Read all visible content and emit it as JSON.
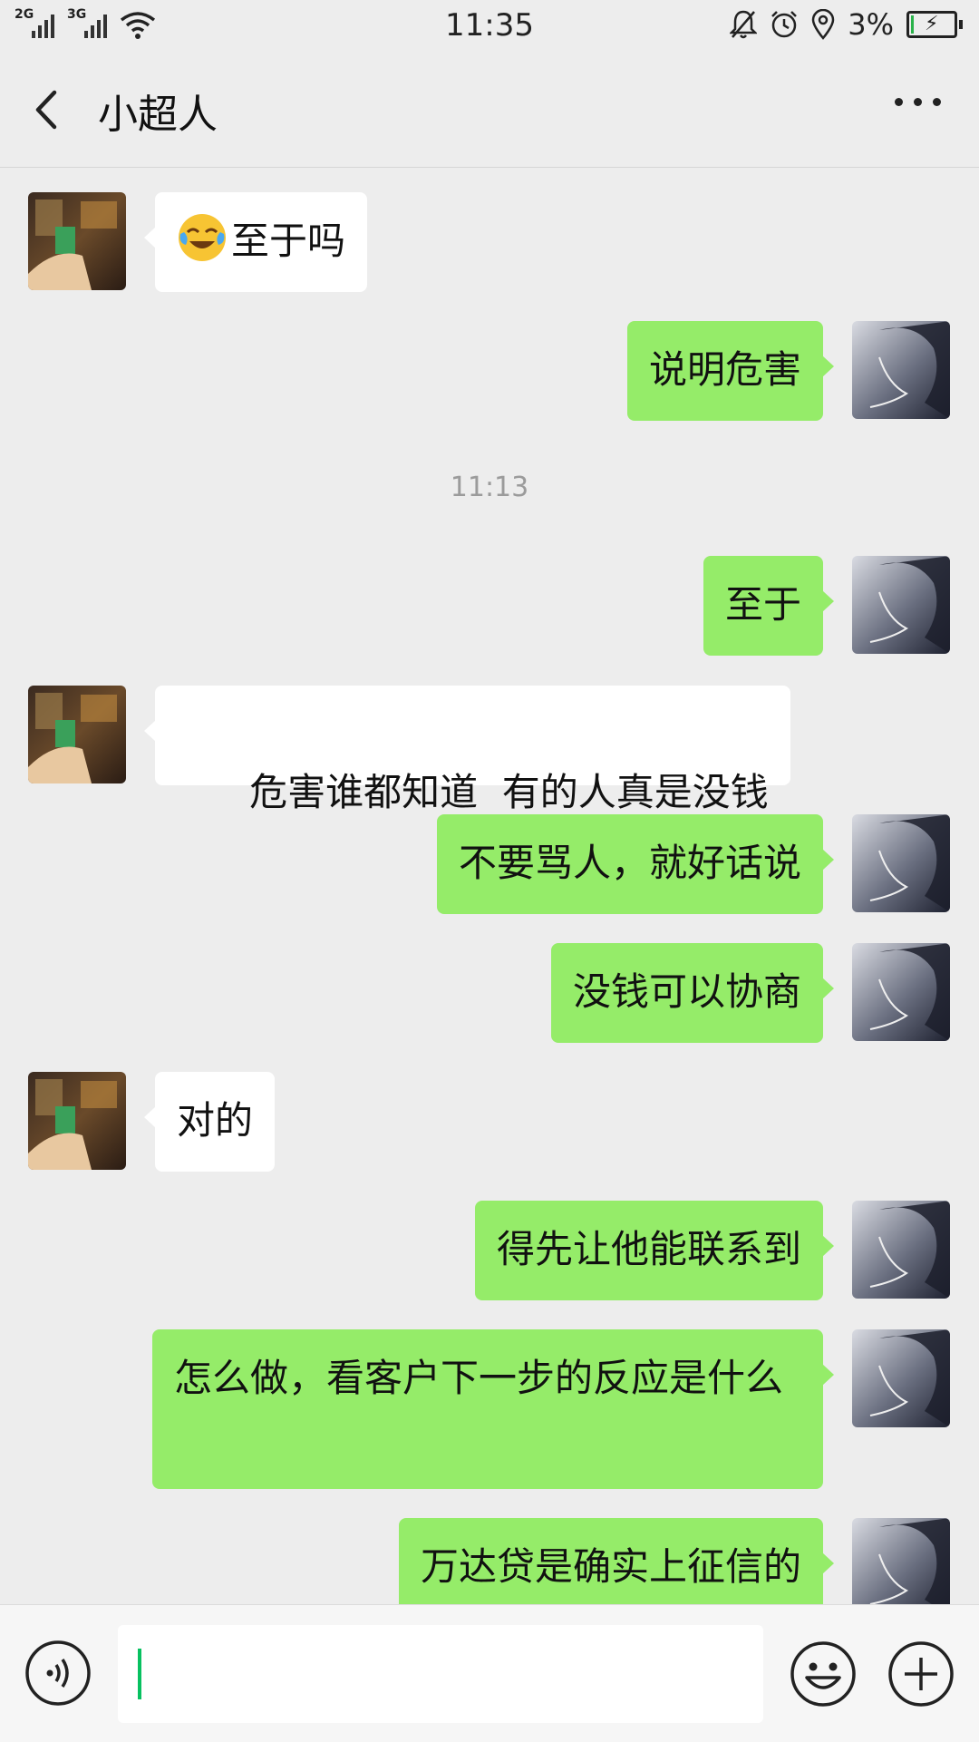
{
  "status_bar": {
    "network1": "2G",
    "network2": "3G",
    "time": "11:35",
    "battery": "3%"
  },
  "header": {
    "title": "小超人"
  },
  "messages": [
    {
      "from": "them",
      "text": "至于吗",
      "emoji": "face-with-tears-of-joy"
    },
    {
      "from": "me",
      "text": "说明危害"
    },
    {
      "type": "timestamp",
      "text": "11:13"
    },
    {
      "from": "me",
      "text": "至于"
    },
    {
      "from": "them",
      "text": "危害谁都知道  有的人真是没钱"
    },
    {
      "from": "me",
      "text": "不要骂人，就好话说"
    },
    {
      "from": "me",
      "text": "没钱可以协商"
    },
    {
      "from": "them",
      "text": "对的"
    },
    {
      "from": "me",
      "text": "得先让他能联系到"
    },
    {
      "from": "me",
      "text": "怎么做，看客户下一步的反应是什么"
    },
    {
      "from": "me",
      "text": "万达贷是确实上征信的"
    }
  ],
  "input_bar": {
    "value": ""
  },
  "colors": {
    "background": "#ededed",
    "bubble_me": "#95ec69",
    "bubble_them": "#ffffff",
    "caret": "#07c160"
  },
  "icons": [
    "back-arrow-icon",
    "more-dots-icon",
    "voice-icon",
    "emoji-icon",
    "plus-icon"
  ]
}
